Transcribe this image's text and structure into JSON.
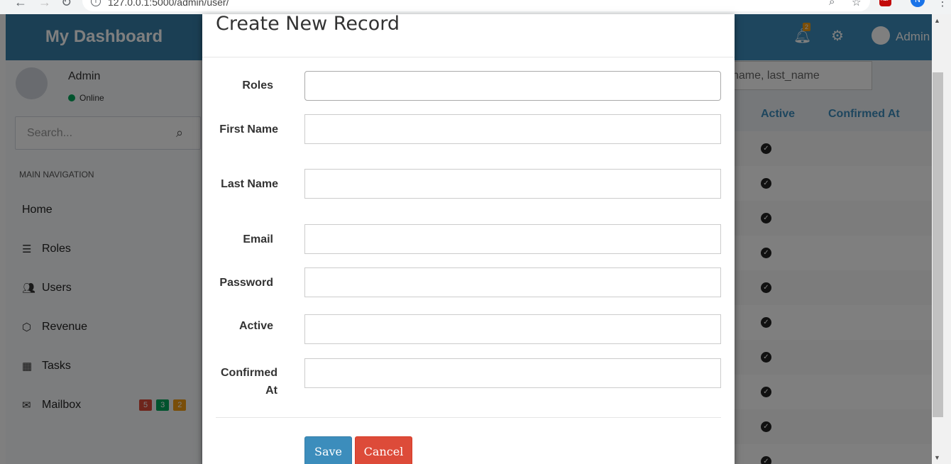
{
  "browser": {
    "url": "127.0.0.1:5000/admin/user/",
    "back_icon": "arrow-left",
    "forward_icon": "arrow-right",
    "reload_icon": "reload",
    "profile_initial": "N"
  },
  "header": {
    "logo": "My Dashboard",
    "notification_count": "2",
    "user_name": "Admin"
  },
  "sidebar": {
    "user_name": "Admin",
    "status": "Online",
    "search_placeholder": "Search...",
    "section_header": "MAIN NAVIGATION",
    "items": [
      {
        "label": "Home",
        "icon": "none"
      },
      {
        "label": "Roles",
        "icon": "server-icon"
      },
      {
        "label": "Users",
        "icon": "users-icon"
      },
      {
        "label": "Revenue",
        "icon": "cube-icon"
      },
      {
        "label": "Tasks",
        "icon": "calendar-icon"
      },
      {
        "label": "Mailbox",
        "icon": "envelope-icon"
      }
    ],
    "mailbox_badges": [
      {
        "value": "5",
        "color": "#dd4b39"
      },
      {
        "value": "3",
        "color": "#00a65a"
      },
      {
        "value": "2",
        "color": "#f39c12"
      }
    ]
  },
  "content": {
    "search_placeholder": "name, last_name",
    "columns": [
      "Active",
      "Confirmed At"
    ]
  },
  "modal": {
    "title": "Create New Record",
    "fields": [
      {
        "label": "Roles",
        "value": ""
      },
      {
        "label": "First Name",
        "value": ""
      },
      {
        "label": "Last Name",
        "value": ""
      },
      {
        "label": "Email",
        "value": ""
      },
      {
        "label": "Password",
        "value": ""
      },
      {
        "label": "Active",
        "value": ""
      },
      {
        "label": "Confirmed",
        "label2": "At",
        "value": ""
      }
    ],
    "save_label": "Save",
    "cancel_label": "Cancel"
  },
  "colors": {
    "primary": "#3c8dbc",
    "danger": "#dd4b39",
    "success": "#00a65a",
    "warning": "#f39c12"
  }
}
